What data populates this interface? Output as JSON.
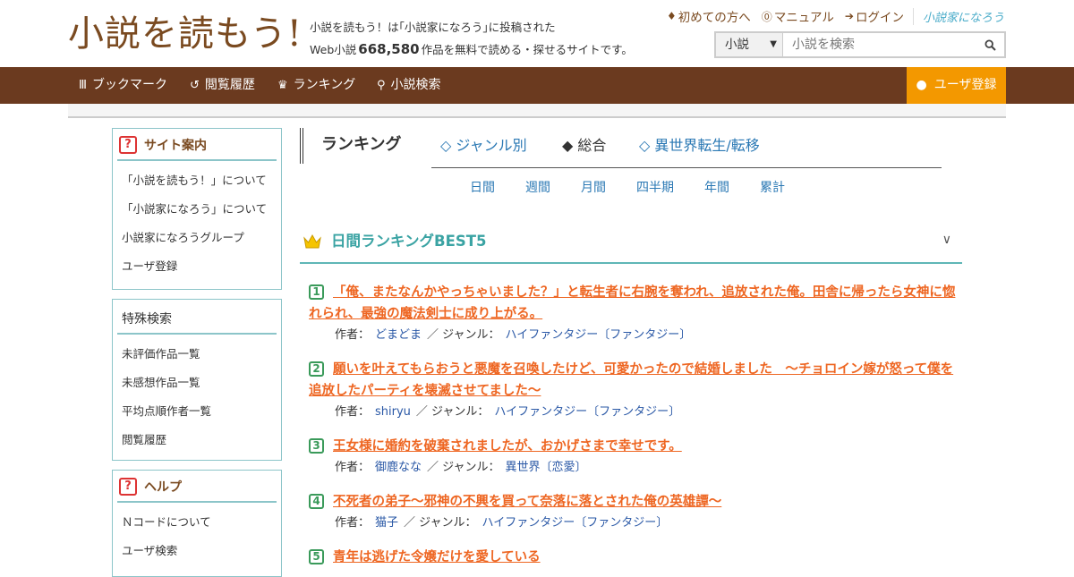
{
  "header": {
    "logo_text": "小説を読もう!",
    "desc_line1": "小説を読もう！は｢小説家になろう｣に投稿された",
    "desc_line2_prefix": "Web小説",
    "work_count": "668,580",
    "desc_line2_suffix": "作品を無料で読める・探せるサイトです。",
    "links": [
      {
        "icon": "beginner-icon",
        "label": "初めての方へ"
      },
      {
        "icon": "question-icon",
        "label": "マニュアル"
      },
      {
        "icon": "login-icon",
        "label": "ログイン"
      }
    ],
    "partner_logo": "小説家になろう",
    "search": {
      "select_value": "小説",
      "placeholder": "小説を検索"
    }
  },
  "nav": {
    "items": [
      {
        "icon": "bookmark-icon",
        "label": "ブックマーク"
      },
      {
        "icon": "history-icon",
        "label": "閲覧履歴"
      },
      {
        "icon": "crown-icon",
        "label": "ランキング"
      },
      {
        "icon": "search-icon",
        "label": "小説検索"
      }
    ],
    "register_label": "ユーザ登録"
  },
  "sidebar": {
    "site_info": {
      "title": "サイト案内",
      "items": [
        "「小説を読もう！」について",
        "「小説家になろう」について",
        "小説家になろうグループ",
        "ユーザ登録"
      ]
    },
    "special_search": {
      "title": "特殊検索",
      "items": [
        "未評価作品一覧",
        "未感想作品一覧",
        "平均点順作者一覧",
        "閲覧履歴"
      ]
    },
    "help": {
      "title": "ヘルプ",
      "items": [
        "Ｎコードについて",
        "ユーザ検索"
      ]
    }
  },
  "ranking": {
    "title": "ランキング",
    "tabs": [
      {
        "label": "◇ ジャンル別",
        "active": false
      },
      {
        "label": "◆ 総合",
        "active": true
      },
      {
        "label": "◇ 異世界転生/転移",
        "active": false
      }
    ],
    "periods": [
      "日間",
      "週間",
      "月間",
      "四半期",
      "年間",
      "累計"
    ],
    "section_title": "日間ランキングBEST5",
    "author_label": "作者：",
    "genre_label": "／ ジャンル：",
    "items": [
      {
        "rank": "1",
        "title": "「俺、またなんかやっちゃいました？」と転生者に右腕を奪われ、追放された俺。田舎に帰ったら女神に惚れられ、最強の魔法剣士に成り上がる。",
        "author": "どまどま",
        "genre": "ハイファンタジー〔ファンタジー〕"
      },
      {
        "rank": "2",
        "title": "願いを叶えてもらおうと悪魔を召喚したけど、可愛かったので結婚しました　〜チョロイン嫁が怒って僕を追放したパーティを壊滅させてました〜",
        "author": "shiryu",
        "genre": "ハイファンタジー〔ファンタジー〕"
      },
      {
        "rank": "3",
        "title": "王女様に婚約を破棄されましたが、おかげさまで幸せです。",
        "author": "御鹿なな",
        "genre": "異世界〔恋愛〕"
      },
      {
        "rank": "4",
        "title": "不死者の弟子～邪神の不興を買って奈落に落とされた俺の英雄譚～",
        "author": "猫子",
        "genre": "ハイファンタジー〔ファンタジー〕"
      },
      {
        "rank": "5",
        "title": "青年は逃げた令嬢だけを愛している",
        "author": "",
        "genre": ""
      }
    ]
  },
  "colors": {
    "nav_bg": "#6b3a1f",
    "register_bg": "#f39800",
    "accent_teal": "#3aa3a3",
    "title_orange": "#ee6622",
    "link_blue": "#2a78b4"
  }
}
